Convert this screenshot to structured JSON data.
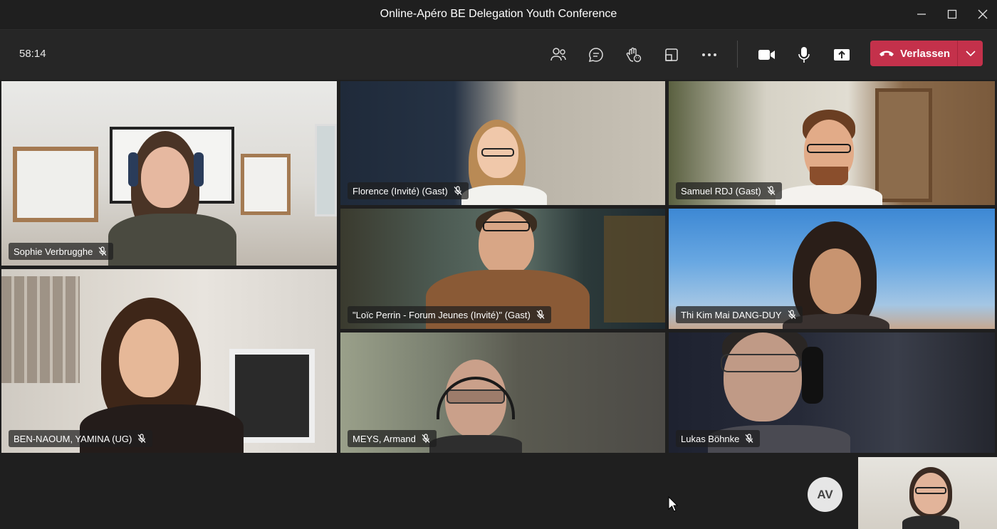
{
  "window": {
    "title": "Online-Apéro BE Delegation Youth Conference"
  },
  "toolbar": {
    "timer": "58:14",
    "buttons": [
      "people-icon",
      "chat-icon",
      "raise-hand-icon",
      "rooms-icon",
      "more-icon",
      "camera-icon",
      "mic-icon",
      "share-icon"
    ],
    "leave_label": "Verlassen",
    "leave_color": "#c4314b"
  },
  "participants": [
    {
      "name": "Sophie Verbrugghe",
      "muted": true
    },
    {
      "name": "Florence (Invité) (Gast)",
      "muted": true
    },
    {
      "name": "Samuel RDJ (Gast)",
      "muted": true
    },
    {
      "name": "\"Loïc Perrin - Forum Jeunes (Invité)\" (Gast)",
      "muted": true
    },
    {
      "name": "Thi Kim Mai DANG-DUY",
      "muted": true
    },
    {
      "name": "BEN-NAOUM, YAMINA (UG)",
      "muted": true
    },
    {
      "name": "MEYS, Armand",
      "muted": true
    },
    {
      "name": "Lukas Böhnke",
      "muted": true
    }
  ],
  "self": {
    "initials": "AV"
  },
  "colors": {
    "background": "#1f1f1f",
    "toolbar": "#262626"
  }
}
